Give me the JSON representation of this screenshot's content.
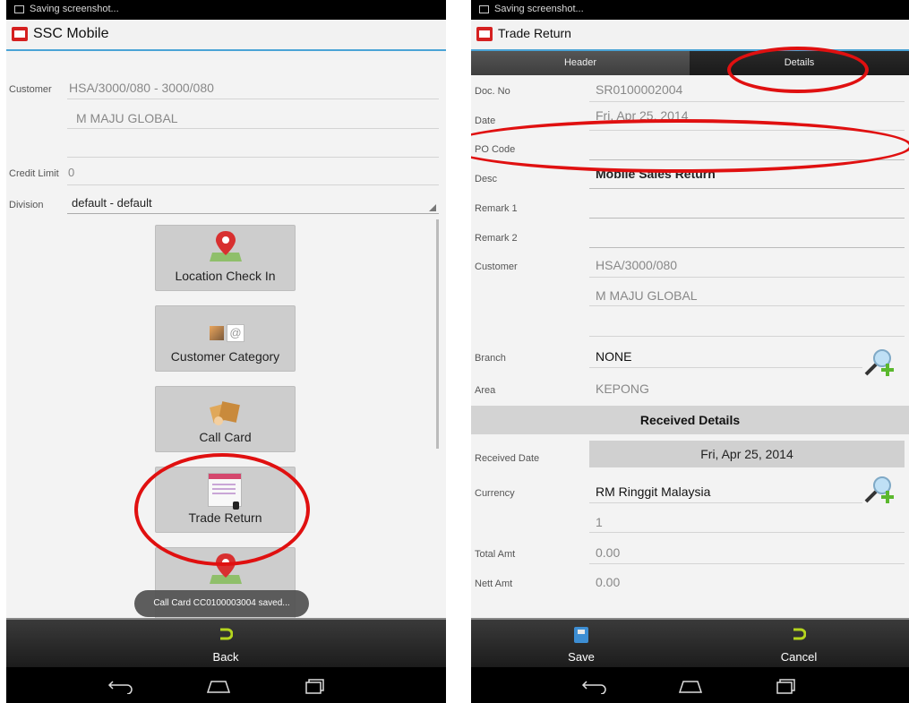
{
  "left": {
    "status_text": "Saving screenshot...",
    "app_title": "SSC Mobile",
    "customer_label": "Customer",
    "customer_code": "HSA/3000/080 - 3000/080",
    "customer_name": "M MAJU GLOBAL",
    "credit_limit_label": "Credit Limit",
    "credit_limit_value": "0",
    "division_label": "Division",
    "division_value": "default - default",
    "menu": [
      {
        "label": "Location Check In",
        "icon": "location-pin-icon"
      },
      {
        "label": "Customer Category",
        "icon": "customer-category-icon"
      },
      {
        "label": "Call Card",
        "icon": "call-card-icon"
      },
      {
        "label": "Trade Return",
        "icon": "trade-return-icon"
      }
    ],
    "toast": "Call Card CC0100003004 saved...",
    "back_label": "Back"
  },
  "right": {
    "status_text": "Saving screenshot...",
    "app_title": "Trade Return",
    "tabs": [
      "Header",
      "Details"
    ],
    "fields": {
      "doc_no_label": "Doc. No",
      "doc_no": "SR0100002004",
      "date_label": "Date",
      "date": "Fri, Apr 25, 2014",
      "po_code_label": "PO Code",
      "po_code": "",
      "desc_label": "Desc",
      "desc": "Mobile Sales Return",
      "remark1_label": "Remark 1",
      "remark1": "",
      "remark2_label": "Remark 2",
      "remark2": "",
      "customer_label": "Customer",
      "customer_code": "HSA/3000/080",
      "customer_name": "M MAJU GLOBAL",
      "branch_label": "Branch",
      "branch": "NONE",
      "area_label": "Area",
      "area": "KEPONG"
    },
    "received_header": "Received Details",
    "received": {
      "received_date_label": "Received Date",
      "received_date": "Fri, Apr 25, 2014",
      "currency_label": "Currency",
      "currency": "RM Ringgit Malaysia",
      "exchange_rate": "1",
      "total_amt_label": "Total Amt",
      "total_amt": "0.00",
      "nett_amt_label": "Nett Amt",
      "nett_amt": "0.00"
    },
    "save_label": "Save",
    "cancel_label": "Cancel"
  },
  "colors": {
    "accent": "#4aa3d6",
    "annotation": "#e01010",
    "pin": "#d83030",
    "undo": "#b5d51e"
  }
}
